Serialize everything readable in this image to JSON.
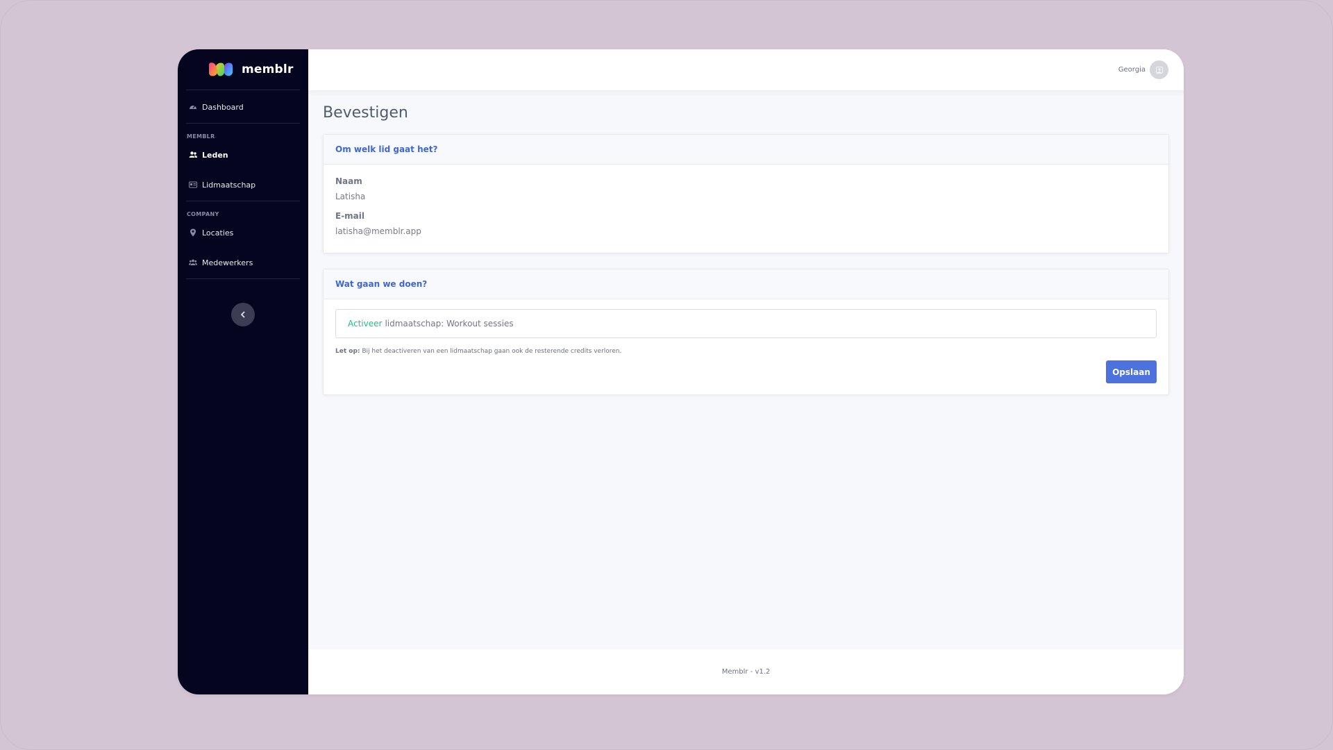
{
  "brand": {
    "name": "memblr"
  },
  "sidebar": {
    "dashboard": {
      "label": "Dashboard",
      "icon": "gauge-icon"
    },
    "section1": "MEMBLR",
    "leden": {
      "label": "Leden",
      "icon": "users-icon"
    },
    "lidmaatschap": {
      "label": "Lidmaatschap",
      "icon": "id-card-icon"
    },
    "section2": "COMPANY",
    "locaties": {
      "label": "Locaties",
      "icon": "map-pin-icon"
    },
    "medewerkers": {
      "label": "Medewerkers",
      "icon": "team-icon"
    }
  },
  "topbar": {
    "user_name": "Georgia"
  },
  "page": {
    "title": "Bevestigen"
  },
  "member_card": {
    "header": "Om welk lid gaat het?",
    "name_label": "Naam",
    "name_value": "Latisha",
    "email_label": "E-mail",
    "email_value": "latisha@memblr.app"
  },
  "action_card": {
    "header": "Wat gaan we doen?",
    "select_action": "Activeer",
    "select_text": "lidmaatschap: Workout sessies",
    "note_bold": "Let op:",
    "note_text": "Bij het deactiveren van een lidmaatschap gaan ook de resterende credits verloren.",
    "save_label": "Opslaan"
  },
  "footer": {
    "text": "Memblr - v1.2"
  },
  "colors": {
    "sidebar_bg": "#05051f",
    "accent_blue": "#4c72dd",
    "header_blue": "#3f66d4",
    "activate_green": "#1fbf84"
  }
}
